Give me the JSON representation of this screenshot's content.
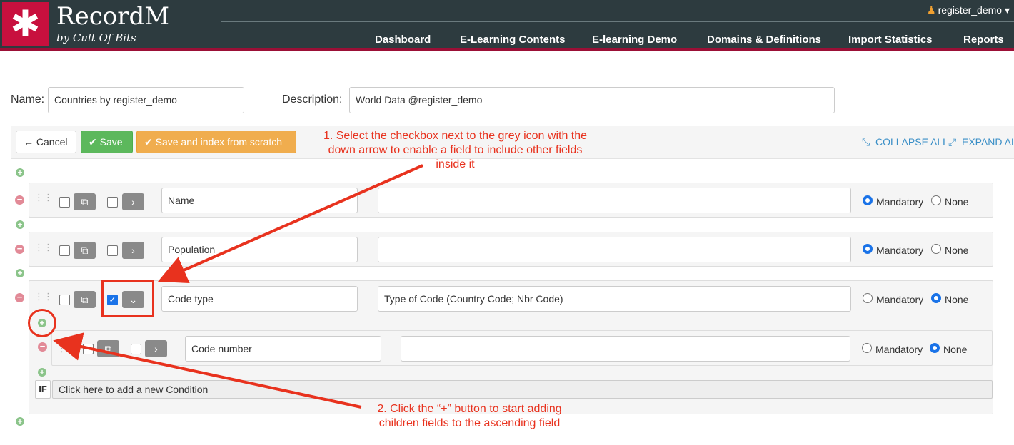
{
  "header": {
    "logo_glyph": "✱",
    "brand": "RecordM",
    "tagline": "by Cult Of Bits",
    "user": "register_demo",
    "nav": [
      "Dashboard",
      "E-Learning Contents",
      "E-learning Demo",
      "Domains & Definitions",
      "Import Statistics",
      "Reports"
    ]
  },
  "form": {
    "name_label": "Name:",
    "name_value": "Countries by register_demo",
    "description_label": "Description:",
    "description_value": "World Data @register_demo"
  },
  "toolbar": {
    "cancel": "Cancel",
    "save": "Save",
    "save_index": "Save and index from scratch",
    "collapse_all": "COLLAPSE ALL",
    "expand_all": "EXPAND ALL"
  },
  "fields": [
    {
      "name": "Name",
      "description": "",
      "required_checked": false,
      "expanded": false,
      "mandatory": true
    },
    {
      "name": "Population",
      "description": "",
      "required_checked": false,
      "expanded": false,
      "mandatory": true
    },
    {
      "name": "Code type",
      "description": "Type of Code (Country Code; Nbr Code)",
      "required_checked": true,
      "expanded": true,
      "mandatory": false
    },
    {
      "name": "Code number",
      "description": "",
      "required_checked": false,
      "expanded": false,
      "mandatory": false
    }
  ],
  "radio_labels": {
    "mandatory": "Mandatory",
    "none": "None"
  },
  "condition": {
    "if_label": "IF",
    "text": "Click here to add a new Condition"
  },
  "annotations": {
    "note1": [
      "1. Select the checkbox next to the grey icon with the",
      "down arrow to enable a field to include other fields",
      "inside it"
    ],
    "note2": [
      "2. Click the “+” button to start adding",
      "children fields to the ascending field"
    ]
  },
  "colors": {
    "header_bg": "#2d3b3f",
    "brand_red": "#c8103e",
    "annotation": "#e8321e",
    "success": "#5cb85c",
    "warning": "#f0ad4e",
    "link": "#3a8fc7"
  }
}
